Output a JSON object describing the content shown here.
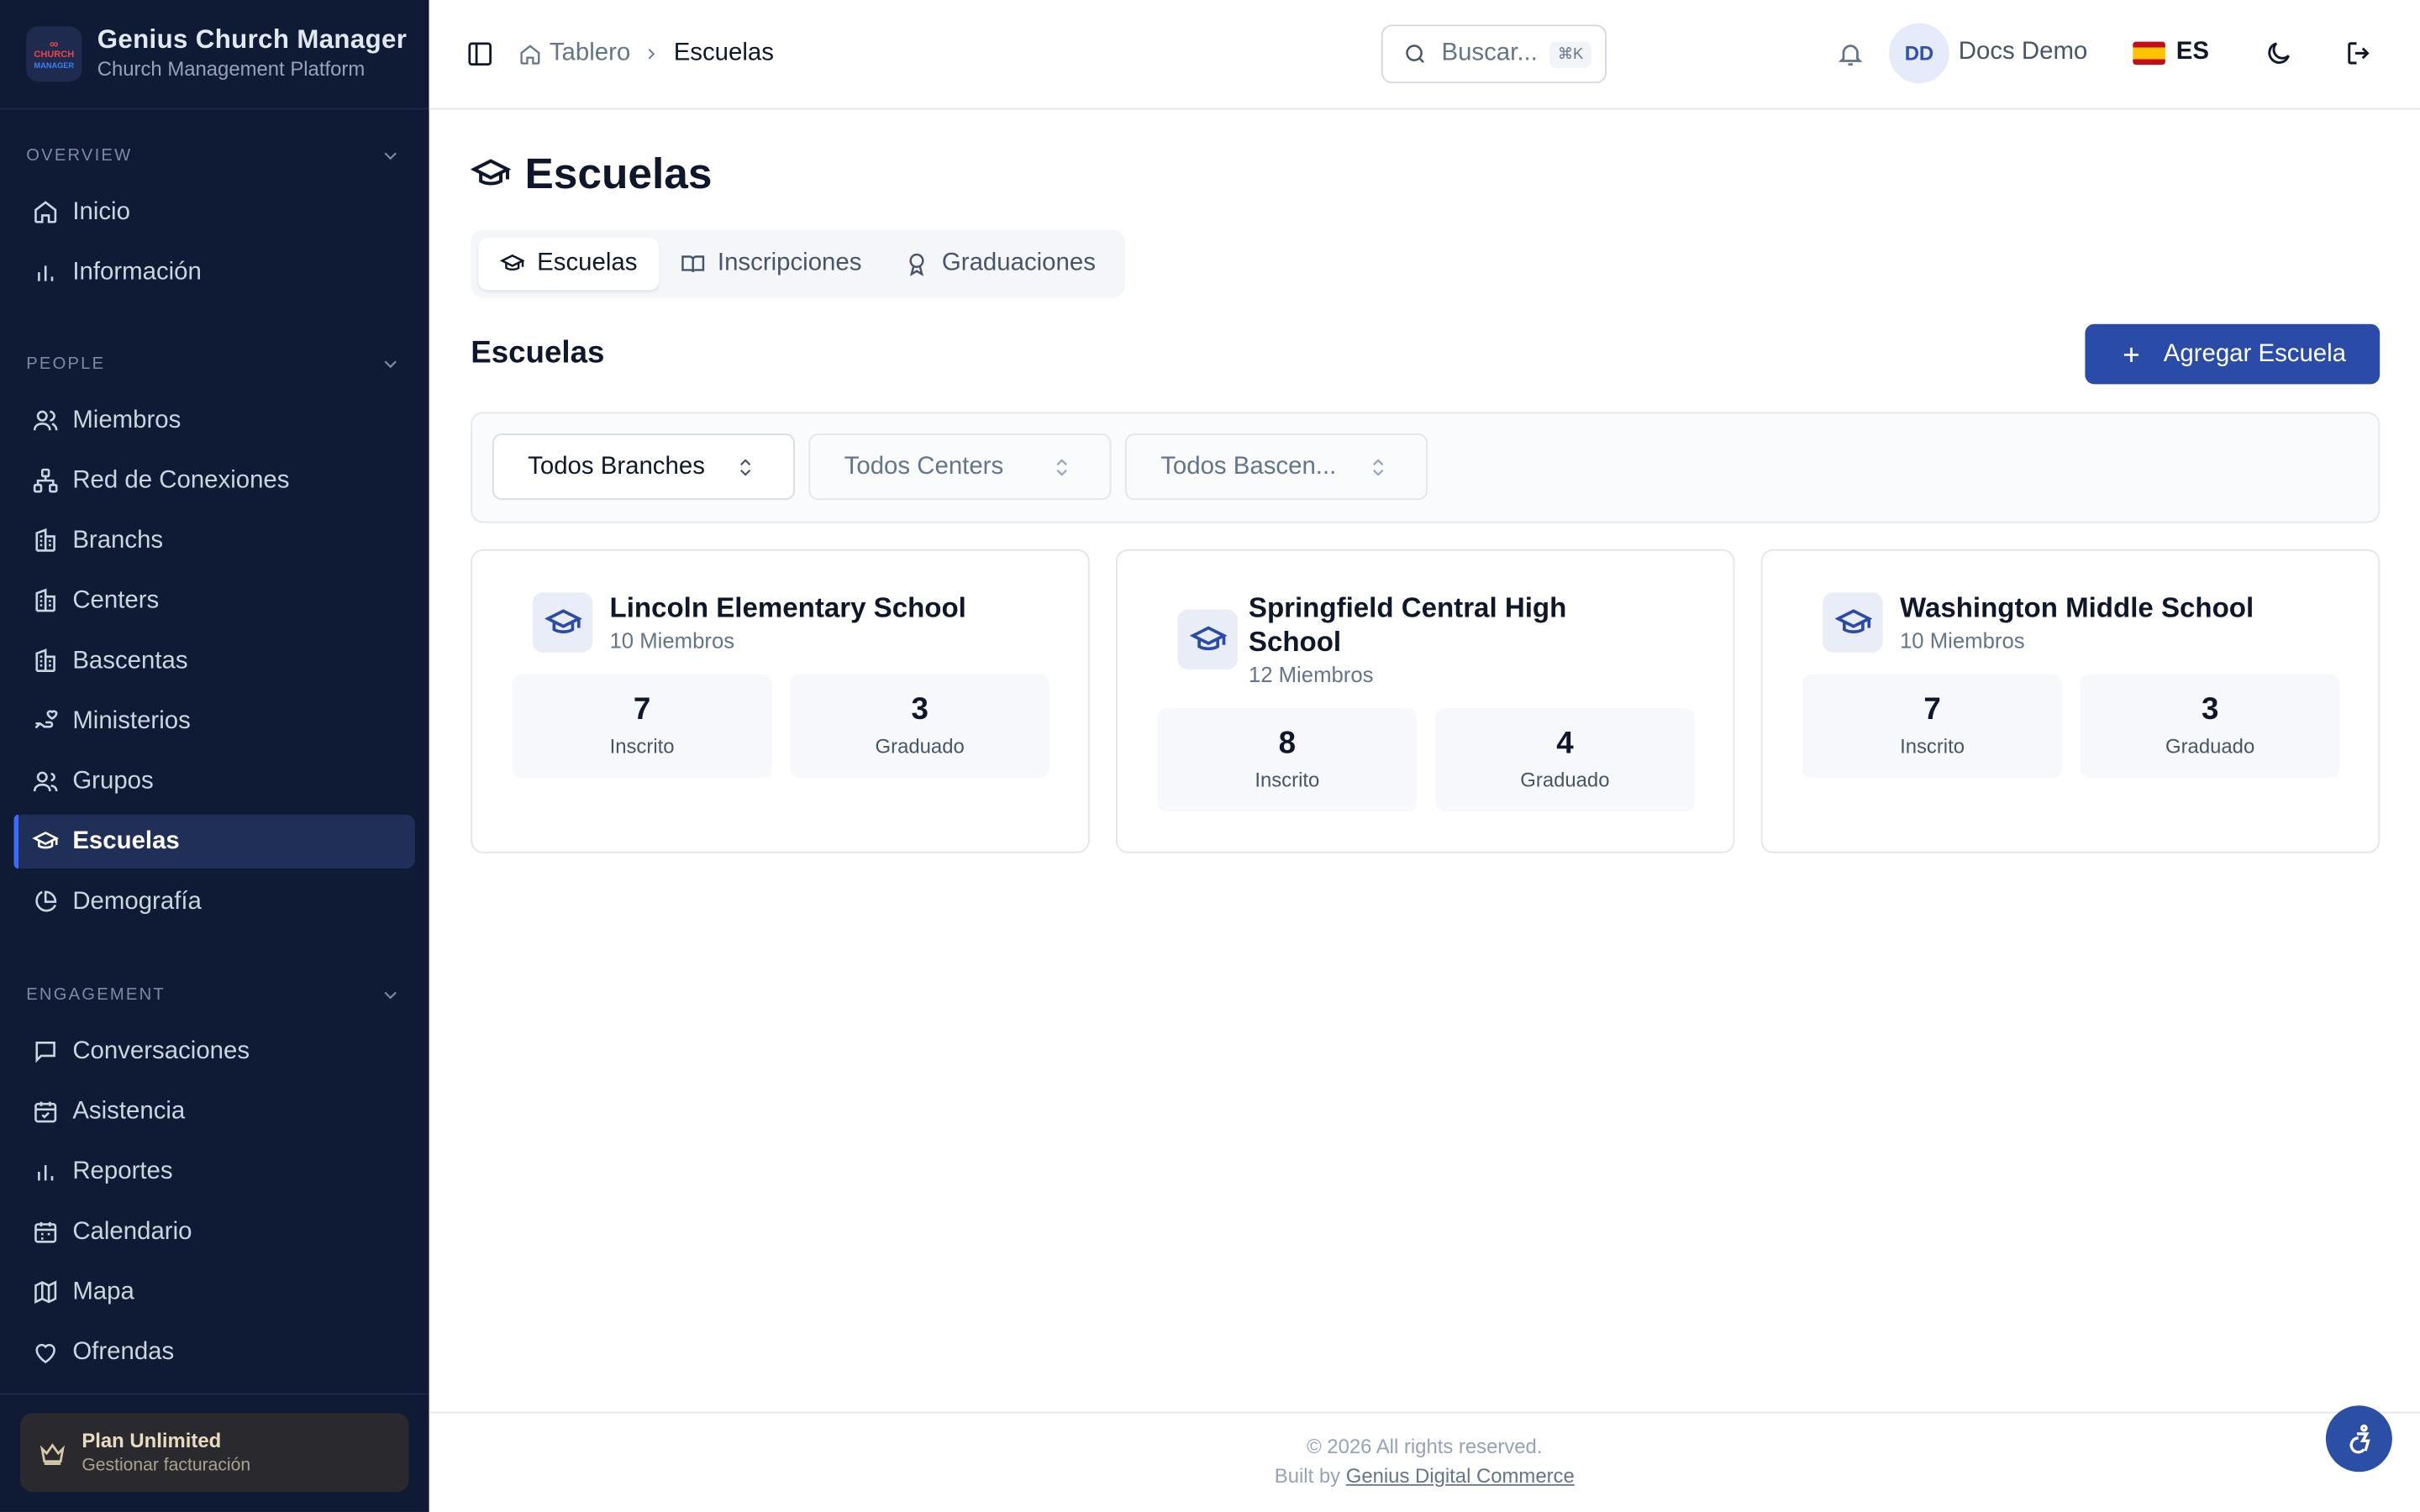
{
  "brand": {
    "title": "Genius Church Manager",
    "subtitle": "Church Management Platform",
    "logo_line1": "CHURCH",
    "logo_line2": "MANAGER"
  },
  "sidebar": {
    "sections": [
      {
        "title": "OVERVIEW",
        "items": [
          {
            "label": "Inicio",
            "icon": "home-icon"
          },
          {
            "label": "Información",
            "icon": "bar-chart-icon"
          }
        ]
      },
      {
        "title": "PEOPLE",
        "items": [
          {
            "label": "Miembros",
            "icon": "users-icon"
          },
          {
            "label": "Red de Conexiones",
            "icon": "network-icon"
          },
          {
            "label": "Branchs",
            "icon": "building-icon"
          },
          {
            "label": "Centers",
            "icon": "building-icon"
          },
          {
            "label": "Bascentas",
            "icon": "building-icon"
          },
          {
            "label": "Ministerios",
            "icon": "hand-heart-icon"
          },
          {
            "label": "Grupos",
            "icon": "user-group-icon"
          },
          {
            "label": "Escuelas",
            "icon": "graduation-cap-icon",
            "active": true
          },
          {
            "label": "Demografía",
            "icon": "pie-chart-icon"
          }
        ]
      },
      {
        "title": "ENGAGEMENT",
        "items": [
          {
            "label": "Conversaciones",
            "icon": "message-icon"
          },
          {
            "label": "Asistencia",
            "icon": "calendar-check-icon"
          },
          {
            "label": "Reportes",
            "icon": "bar-chart-icon"
          },
          {
            "label": "Calendario",
            "icon": "calendar-icon"
          },
          {
            "label": "Mapa",
            "icon": "map-icon"
          },
          {
            "label": "Ofrendas",
            "icon": "heart-icon"
          }
        ]
      }
    ],
    "plan": {
      "title": "Plan Unlimited",
      "subtitle": "Gestionar facturación"
    }
  },
  "header": {
    "breadcrumb": {
      "home": "Tablero",
      "current": "Escuelas"
    },
    "search": {
      "placeholder": "Buscar...",
      "shortcut": "⌘K"
    },
    "user": {
      "initials": "DD",
      "name": "Docs Demo"
    },
    "language": "ES"
  },
  "page": {
    "title": "Escuelas",
    "tabs": [
      {
        "label": "Escuelas",
        "icon": "graduation-cap-icon",
        "active": true
      },
      {
        "label": "Inscripciones",
        "icon": "book-open-icon"
      },
      {
        "label": "Graduaciones",
        "icon": "award-icon"
      }
    ],
    "section_title": "Escuelas",
    "add_button": "Agregar Escuela",
    "filters": [
      {
        "value": "Todos Branches",
        "enabled": true
      },
      {
        "value": "Todos Centers",
        "enabled": false
      },
      {
        "value": "Todos Bascen...",
        "enabled": false
      }
    ],
    "schools": [
      {
        "name": "Lincoln Elementary School",
        "members": "10 Miembros",
        "enrolled": "7",
        "enrolled_label": "Inscrito",
        "graduated": "3",
        "graduated_label": "Graduado"
      },
      {
        "name": "Springfield Central High School",
        "members": "12 Miembros",
        "enrolled": "8",
        "enrolled_label": "Inscrito",
        "graduated": "4",
        "graduated_label": "Graduado"
      },
      {
        "name": "Washington Middle School",
        "members": "10 Miembros",
        "enrolled": "7",
        "enrolled_label": "Inscrito",
        "graduated": "3",
        "graduated_label": "Graduado"
      }
    ]
  },
  "footer": {
    "copyright": "© 2026 All rights reserved.",
    "built_by_prefix": "Built by",
    "built_by_link": "Genius Digital Commerce"
  },
  "colors": {
    "sidebar_bg": "#0f1a35",
    "primary": "#2b4ba8",
    "active_item_bg": "#1f2f58"
  }
}
